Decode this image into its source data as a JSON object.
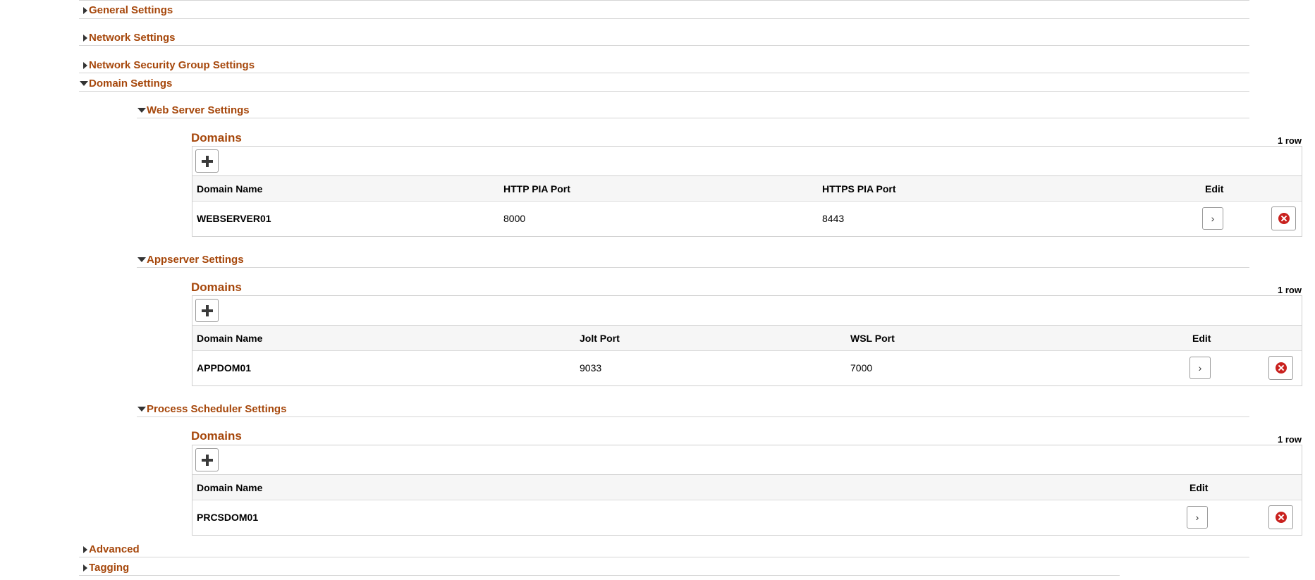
{
  "sections": {
    "general": "General Settings",
    "network": "Network Settings",
    "nsg": "Network Security Group Settings",
    "domain": "Domain Settings",
    "web": "Web Server Settings",
    "app": "Appserver Settings",
    "prcs": "Process Scheduler Settings",
    "advanced": "Advanced",
    "tagging": "Tagging"
  },
  "web_grid": {
    "title": "Domains",
    "row_count": "1 row",
    "headers": [
      "Domain Name",
      "HTTP PIA Port",
      "HTTPS PIA Port",
      "Edit"
    ],
    "rows": [
      {
        "domain": "WEBSERVER01",
        "http": "8000",
        "https": "8443"
      }
    ]
  },
  "app_grid": {
    "title": "Domains",
    "row_count": "1 row",
    "headers": [
      "Domain Name",
      "Jolt Port",
      "WSL Port",
      "Edit"
    ],
    "rows": [
      {
        "domain": "APPDOM01",
        "jolt": "9033",
        "wsl": "7000"
      }
    ]
  },
  "prcs_grid": {
    "title": "Domains",
    "row_count": "1 row",
    "headers": [
      "Domain Name",
      "Edit"
    ],
    "rows": [
      {
        "domain": "PRCSDOM01"
      }
    ]
  },
  "icons": {
    "collapsed": "triangle-right-icon",
    "expanded": "triangle-down-icon",
    "add": "plus-icon",
    "edit": "chevron-right-icon",
    "delete": "delete-circle-icon"
  },
  "colors": {
    "accent": "#a6470b",
    "delete": "#c9211e"
  }
}
